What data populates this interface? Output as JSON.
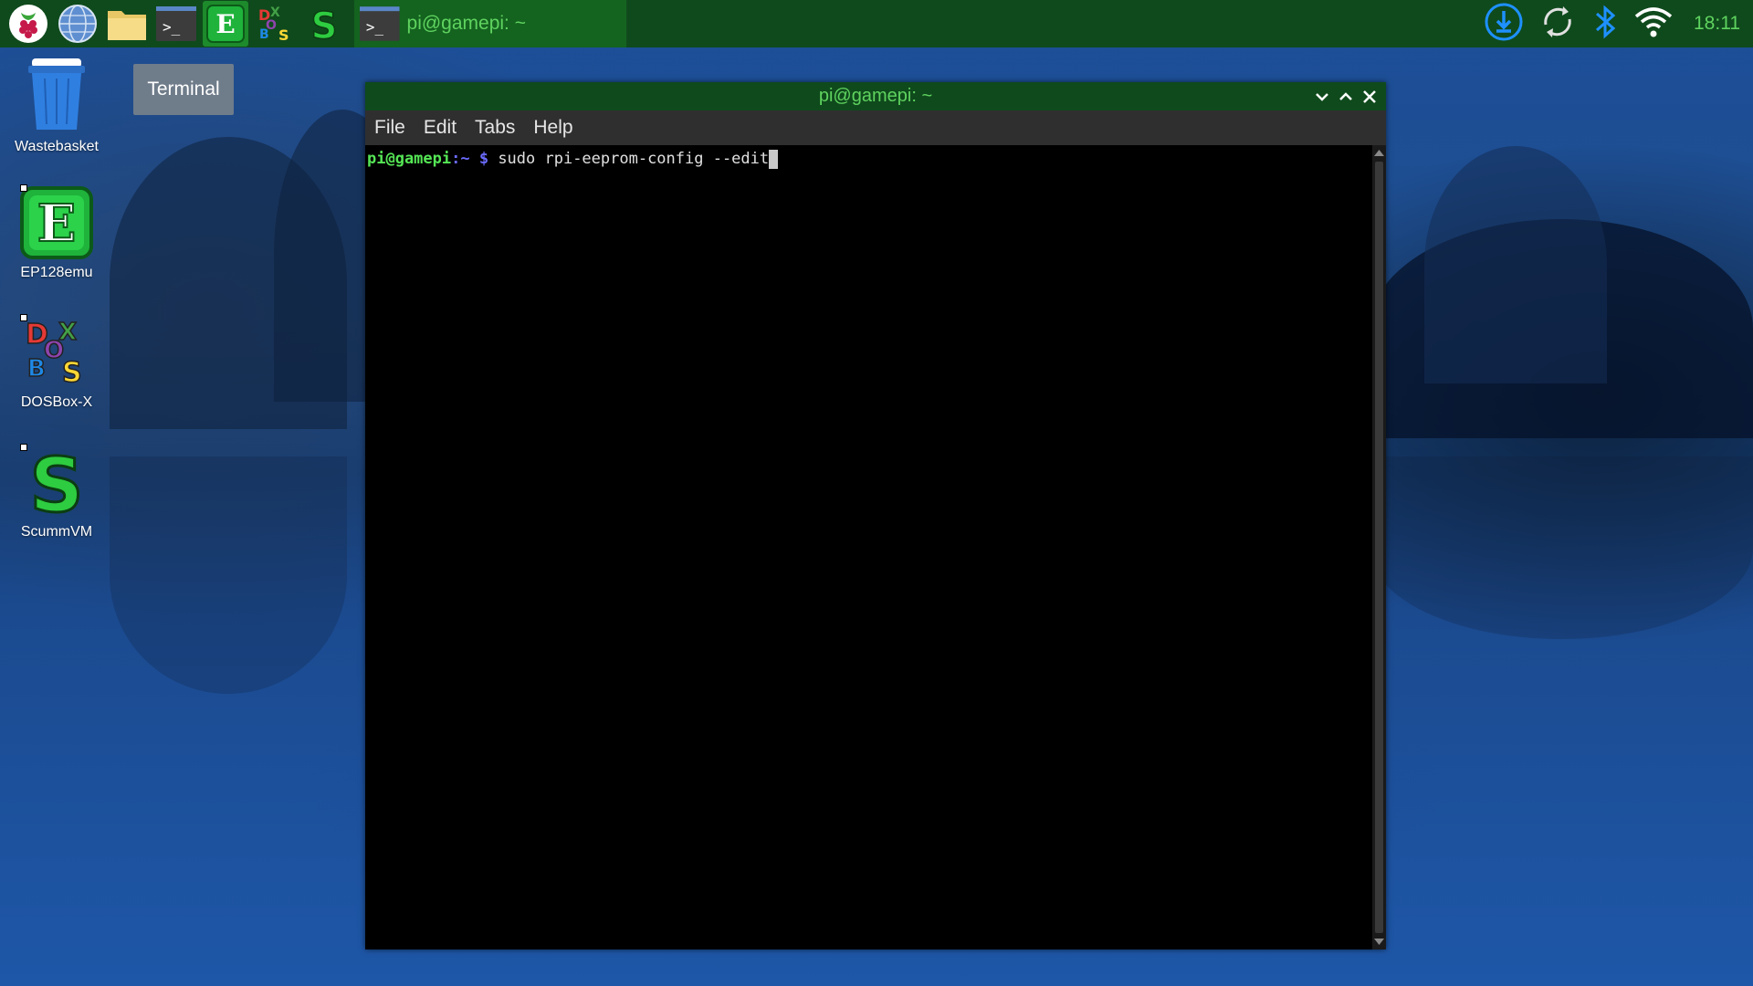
{
  "taskbar": {
    "launchers": [
      {
        "name": "raspberry-menu",
        "icon": "raspberry-icon"
      },
      {
        "name": "web-browser",
        "icon": "globe-icon"
      },
      {
        "name": "file-manager",
        "icon": "folder-icon"
      },
      {
        "name": "terminal",
        "icon": "terminal-icon"
      },
      {
        "name": "ep128emu",
        "icon": "ep128emu-icon"
      },
      {
        "name": "dosbox-x",
        "icon": "dosbox-icon"
      },
      {
        "name": "scummvm",
        "icon": "scummvm-icon"
      }
    ],
    "active_task": {
      "title": "pi@gamepi: ~",
      "icon": "terminal-icon"
    },
    "tray": {
      "icons": [
        "download-updates-icon",
        "sync-icon",
        "bluetooth-icon",
        "wifi-icon"
      ],
      "clock": "18:11"
    }
  },
  "desktop": {
    "icons": [
      {
        "label": "Wastebasket",
        "icon": "wastebasket-icon"
      },
      {
        "label": "EP128emu",
        "icon": "ep128emu-icon"
      },
      {
        "label": "DOSBox-X",
        "icon": "dosbox-icon"
      },
      {
        "label": "ScummVM",
        "icon": "scummvm-icon"
      }
    ]
  },
  "tooltip": {
    "text": "Terminal"
  },
  "terminal_window": {
    "title": "pi@gamepi: ~",
    "menu": [
      "File",
      "Edit",
      "Tabs",
      "Help"
    ],
    "prompt": {
      "user_host": "pi@gamepi",
      "path": ":~ $ ",
      "command": "sudo rpi-eeprom-config --edit"
    }
  },
  "colors": {
    "panel_bg": "#0f4a1c",
    "panel_text": "#5fd35f",
    "terminal_bg": "#000000",
    "prompt_user": "#55e655",
    "prompt_path": "#6b6bff",
    "tray_icon": "#1e90ff"
  }
}
